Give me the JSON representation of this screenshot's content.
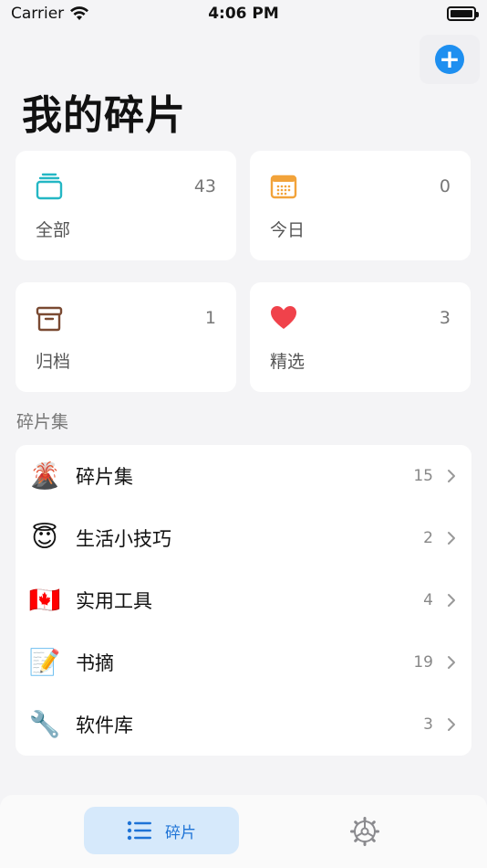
{
  "status": {
    "carrier": "Carrier",
    "time": "4:06 PM"
  },
  "header": {
    "title": "我的碎片"
  },
  "cards": [
    {
      "label": "全部",
      "count": "43",
      "icon": "tray-stack-icon",
      "color": "#24b7c4"
    },
    {
      "label": "今日",
      "count": "0",
      "icon": "calendar-icon",
      "color": "#f2a33a"
    },
    {
      "label": "归档",
      "count": "1",
      "icon": "archive-box-icon",
      "color": "#7a4a32"
    },
    {
      "label": "精选",
      "count": "3",
      "icon": "heart-icon",
      "color": "#f0424b"
    }
  ],
  "section": {
    "title": "碎片集"
  },
  "collections": [
    {
      "emoji": "🌋",
      "label": "碎片集",
      "count": "15"
    },
    {
      "emoji": "😇",
      "label": "生活小技巧",
      "count": "2"
    },
    {
      "emoji": "🇨🇦",
      "label": "实用工具",
      "count": "4"
    },
    {
      "emoji": "📝",
      "label": "书摘",
      "count": "19"
    },
    {
      "emoji": "🔧",
      "label": "软件库",
      "count": "3"
    }
  ],
  "tabbar": {
    "fragments_label": "碎片"
  },
  "colors": {
    "accent": "#1e8ff0",
    "tab_active_bg": "#d6e9fb"
  }
}
